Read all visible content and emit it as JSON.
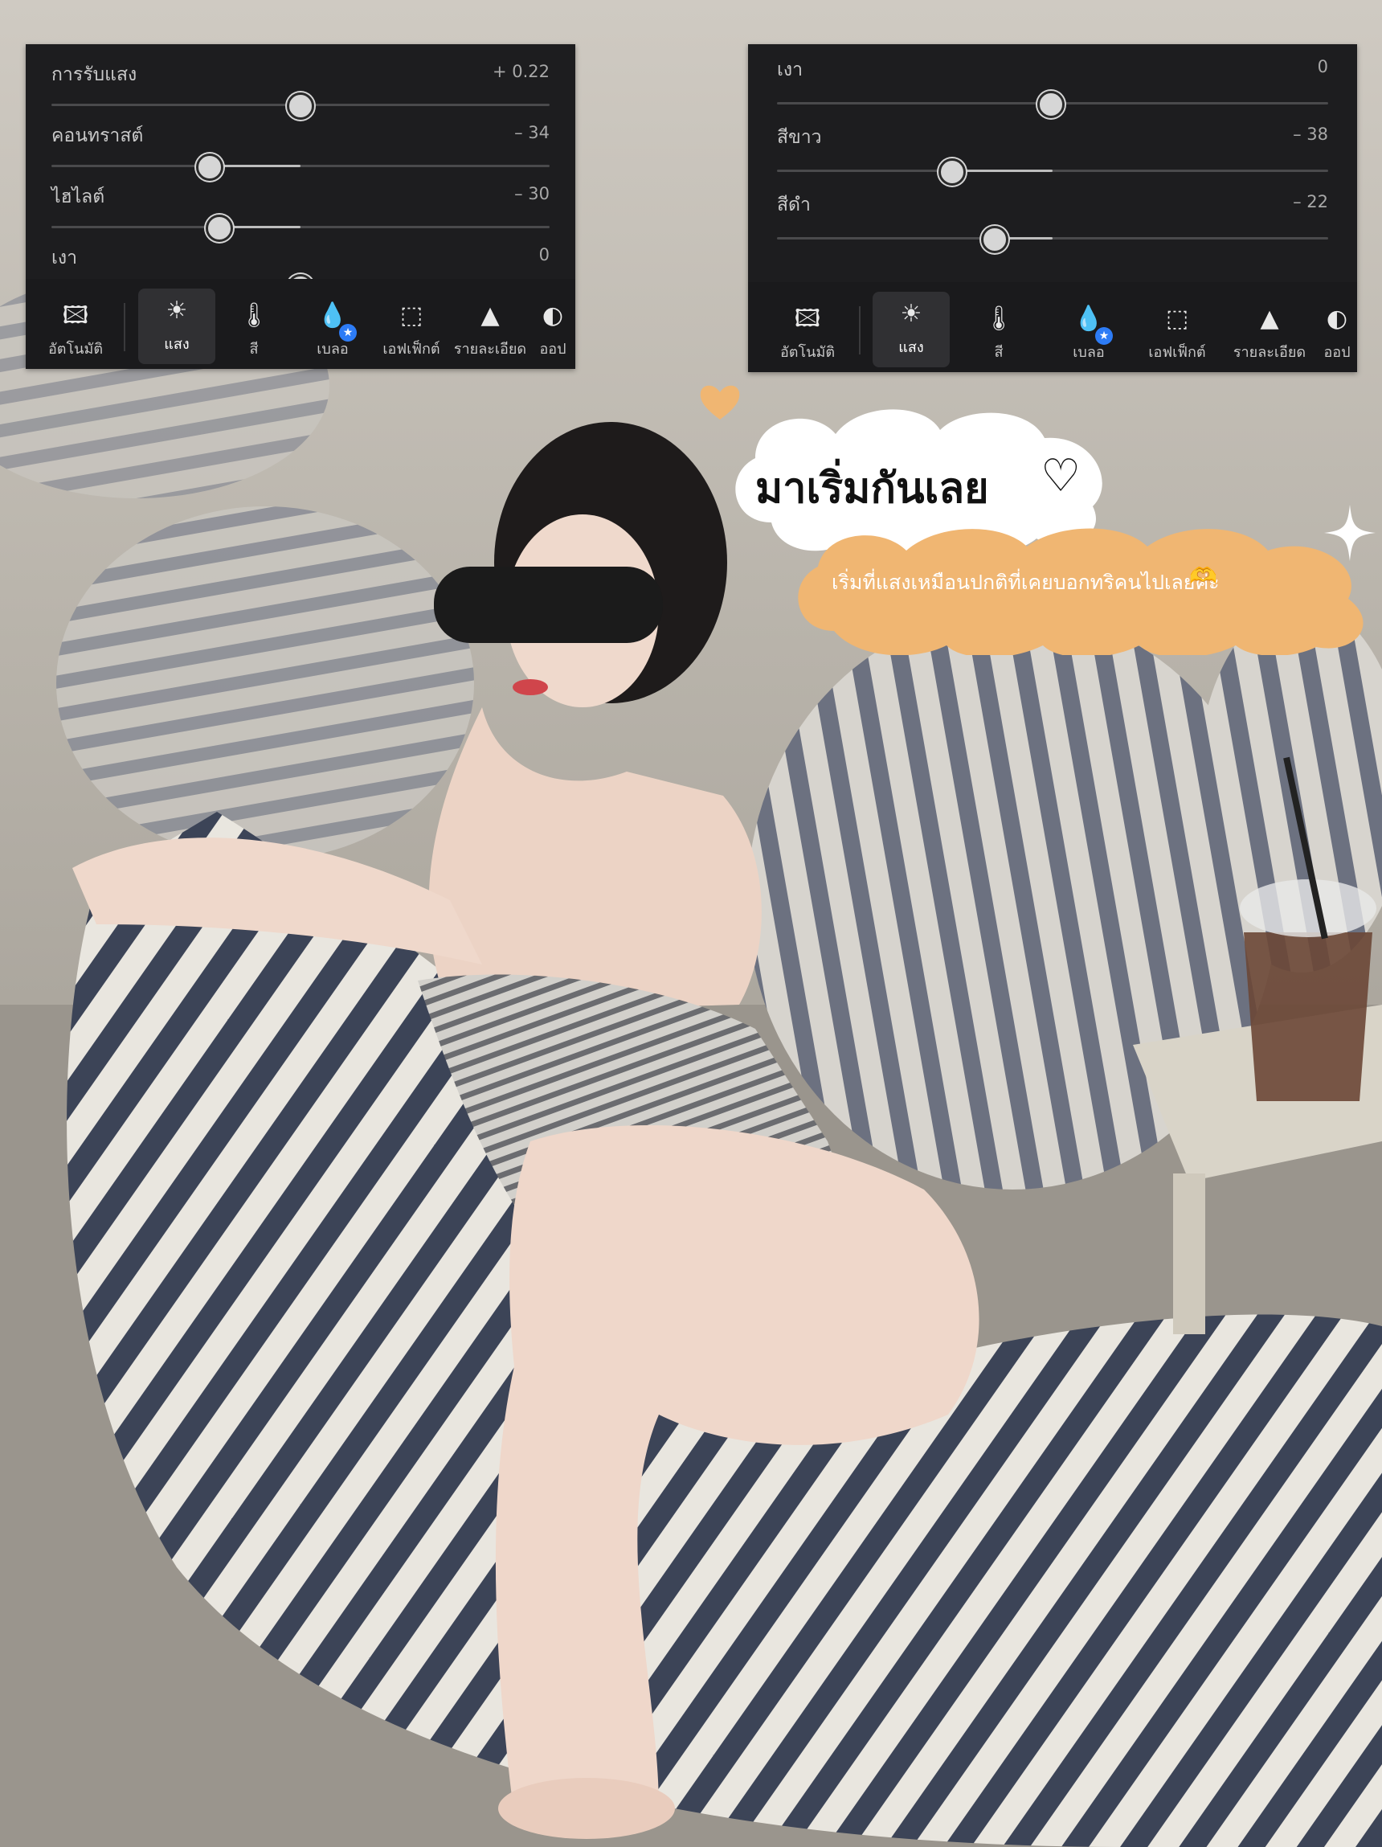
{
  "left_panel": {
    "sliders": [
      {
        "label": "การรับแสง",
        "value": "+ 0.22",
        "level": 0.53
      },
      {
        "label": "คอนทราสต์",
        "value": "– 34",
        "level": 0.33
      },
      {
        "label": "ไฮไลต์",
        "value": "– 30",
        "level": 0.35
      },
      {
        "label": "เงา",
        "value": "0",
        "level": 0.5
      }
    ]
  },
  "right_panel": {
    "sliders": [
      {
        "label": "เงา",
        "value": "0",
        "level": 0.5
      },
      {
        "label": "สีขาว",
        "value": "– 38",
        "level": 0.31
      },
      {
        "label": "สีดำ",
        "value": "– 22",
        "level": 0.39
      }
    ]
  },
  "toolbar": {
    "tools": [
      {
        "label": "อัตโนมัติ",
        "icon": "auto-enhance-icon"
      },
      {
        "label": "แสง",
        "icon": "sun-icon",
        "active": true
      },
      {
        "label": "สี",
        "icon": "thermometer-icon"
      },
      {
        "label": "เบลอ",
        "icon": "drop-icon",
        "badge": "★"
      },
      {
        "label": "เอฟเฟ็กต์",
        "icon": "vignette-icon"
      },
      {
        "label": "รายละเอียด",
        "icon": "triangle-icon"
      },
      {
        "label": "ออป",
        "icon": "optics-icon"
      }
    ]
  },
  "sticker": {
    "title": "มาเริ่มกันเลย",
    "title_heart": "♡",
    "subtitle": "เริ่มที่แสงเหมือนปกติที่เคยบอกทริคนไปเลยค่ะ",
    "subtitle_emoji": "🫶"
  },
  "colors": {
    "panel_bg": "#1d1d1f",
    "sticker_orange": "#f0b672",
    "sticker_white": "#ffffff"
  }
}
